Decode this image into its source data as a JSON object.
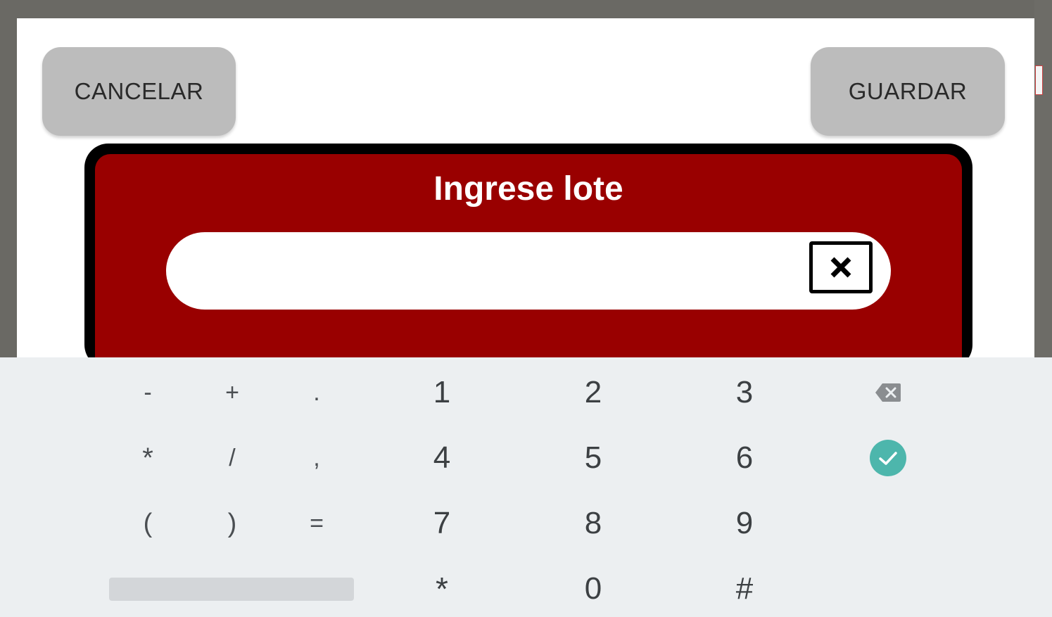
{
  "buttons": {
    "cancel_label": "CANCELAR",
    "save_label": "GUARDAR"
  },
  "dialog": {
    "title": "Ingrese lote",
    "input_value": "",
    "clear_icon": "close-box-icon"
  },
  "keyboard": {
    "rows": [
      [
        "-",
        "+",
        ".",
        "1",
        "2",
        "3",
        "backspace-icon"
      ],
      [
        "*",
        "/",
        ",",
        "4",
        "5",
        "6",
        "check-circle-icon"
      ],
      [
        "(",
        ")",
        "=",
        "7",
        "8",
        "9"
      ],
      [
        "space",
        "*",
        "0",
        "#"
      ]
    ]
  },
  "colors": {
    "dialog_red": "#990000",
    "button_gray": "#bcbcbc",
    "keyboard_bg": "#eceff1",
    "accent_teal": "#4db6ac"
  }
}
